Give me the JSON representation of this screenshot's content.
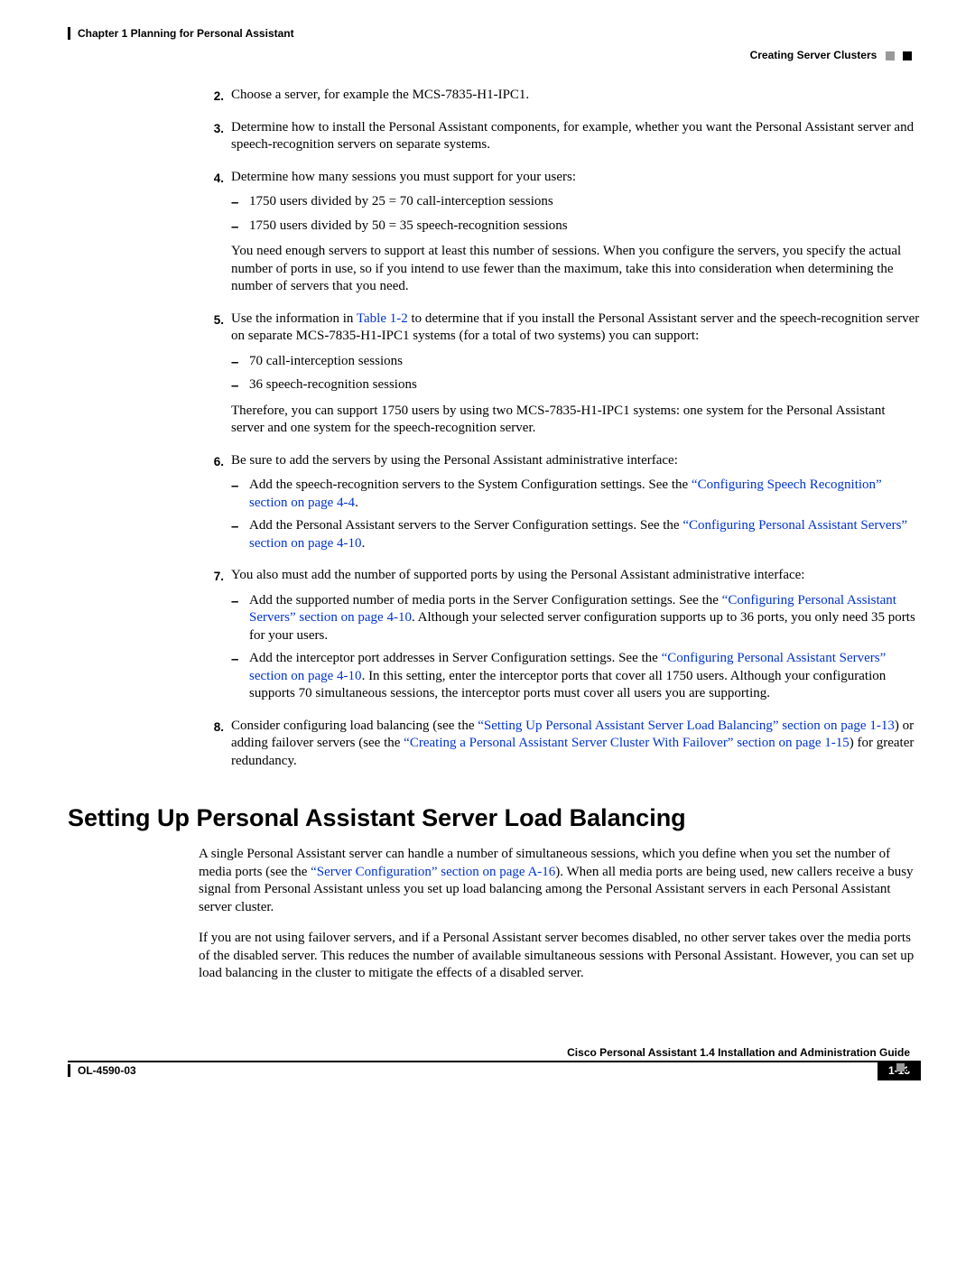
{
  "header": {
    "chapter": "Chapter 1      Planning for Personal Assistant",
    "section": "Creating Server Clusters"
  },
  "steps": {
    "s2": {
      "num": "2.",
      "text": "Choose a server, for example the MCS-7835-H1-IPC1."
    },
    "s3": {
      "num": "3.",
      "text": "Determine how to install the Personal Assistant components, for example, whether you want the Personal Assistant server and speech-recognition servers on separate systems."
    },
    "s4": {
      "num": "4.",
      "intro": "Determine how many sessions you must support for your users:",
      "b1": "1750 users divided by 25 = 70 call-interception sessions",
      "b2": "1750 users divided by 50 = 35 speech-recognition sessions",
      "after": "You need enough servers to support at least this number of sessions. When you configure the servers, you specify the actual number of ports in use, so if you intend to use fewer than the maximum, take this into consideration when determining the number of servers that you need."
    },
    "s5": {
      "num": "5.",
      "intro_a": "Use the information in ",
      "link": "Table 1-2",
      "intro_b": " to determine that if you install the Personal Assistant server and the speech-recognition server on separate MCS-7835-H1-IPC1 systems (for a total of two systems) you can support:",
      "b1": "70 call-interception sessions",
      "b2": "36 speech-recognition sessions",
      "after": "Therefore, you can support 1750 users by using two MCS-7835-H1-IPC1 systems: one system for the Personal Assistant server and one system for the speech-recognition server."
    },
    "s6": {
      "num": "6.",
      "intro": "Be sure to add the servers by using the Personal Assistant administrative interface:",
      "b1_a": "Add the speech-recognition servers to the System Configuration settings. See the ",
      "b1_link": "“Configuring Speech Recognition” section on page 4-4",
      "b1_b": ".",
      "b2_a": "Add the Personal Assistant servers to the Server Configuration settings. See the ",
      "b2_link": "“Configuring Personal Assistant Servers” section on page 4-10",
      "b2_b": "."
    },
    "s7": {
      "num": "7.",
      "intro": "You also must add the number of supported ports by using the Personal Assistant administrative interface:",
      "b1_a": "Add the supported number of media ports in the Server Configuration settings. See the ",
      "b1_link": "“Configuring Personal Assistant Servers” section on page 4-10",
      "b1_b": ". Although your selected server configuration supports up to 36 ports, you only need 35 ports for your users.",
      "b2_a": "Add the interceptor port addresses in Server Configuration settings. See the ",
      "b2_link": "“Configuring Personal Assistant Servers” section on page 4-10",
      "b2_b": ". In this setting, enter the interceptor ports that cover all 1750 users. Although your configuration supports 70 simultaneous sessions, the interceptor ports must cover all users you are supporting."
    },
    "s8": {
      "num": "8.",
      "a": "Consider configuring load balancing (see the ",
      "link1": "“Setting Up Personal Assistant Server Load Balancing” section on page 1-13",
      "b": ") or adding failover servers (see the ",
      "link2": "“Creating a Personal Assistant Server Cluster With Failover” section on page 1-15",
      "c": ") for greater redundancy."
    }
  },
  "heading": "Setting Up Personal Assistant Server Load Balancing",
  "para1_a": "A single Personal Assistant server can handle a number of simultaneous sessions, which you define when you set the number of media ports (see the ",
  "para1_link": "“Server Configuration” section on page A-16",
  "para1_b": "). When all media ports are being used, new callers receive a busy signal from Personal Assistant unless you set up load balancing among the Personal Assistant servers in each Personal Assistant server cluster.",
  "para2": "If you are not using failover servers, and if a Personal Assistant server becomes disabled, no other server takes over the media ports of the disabled server. This reduces the number of available simultaneous sessions with Personal Assistant. However, you can set up load balancing in the cluster to mitigate the effects of a disabled server.",
  "footer": {
    "guide": "Cisco Personal Assistant 1.4 Installation and Administration Guide",
    "docid": "OL-4590-03",
    "pagenum": "1-13"
  }
}
